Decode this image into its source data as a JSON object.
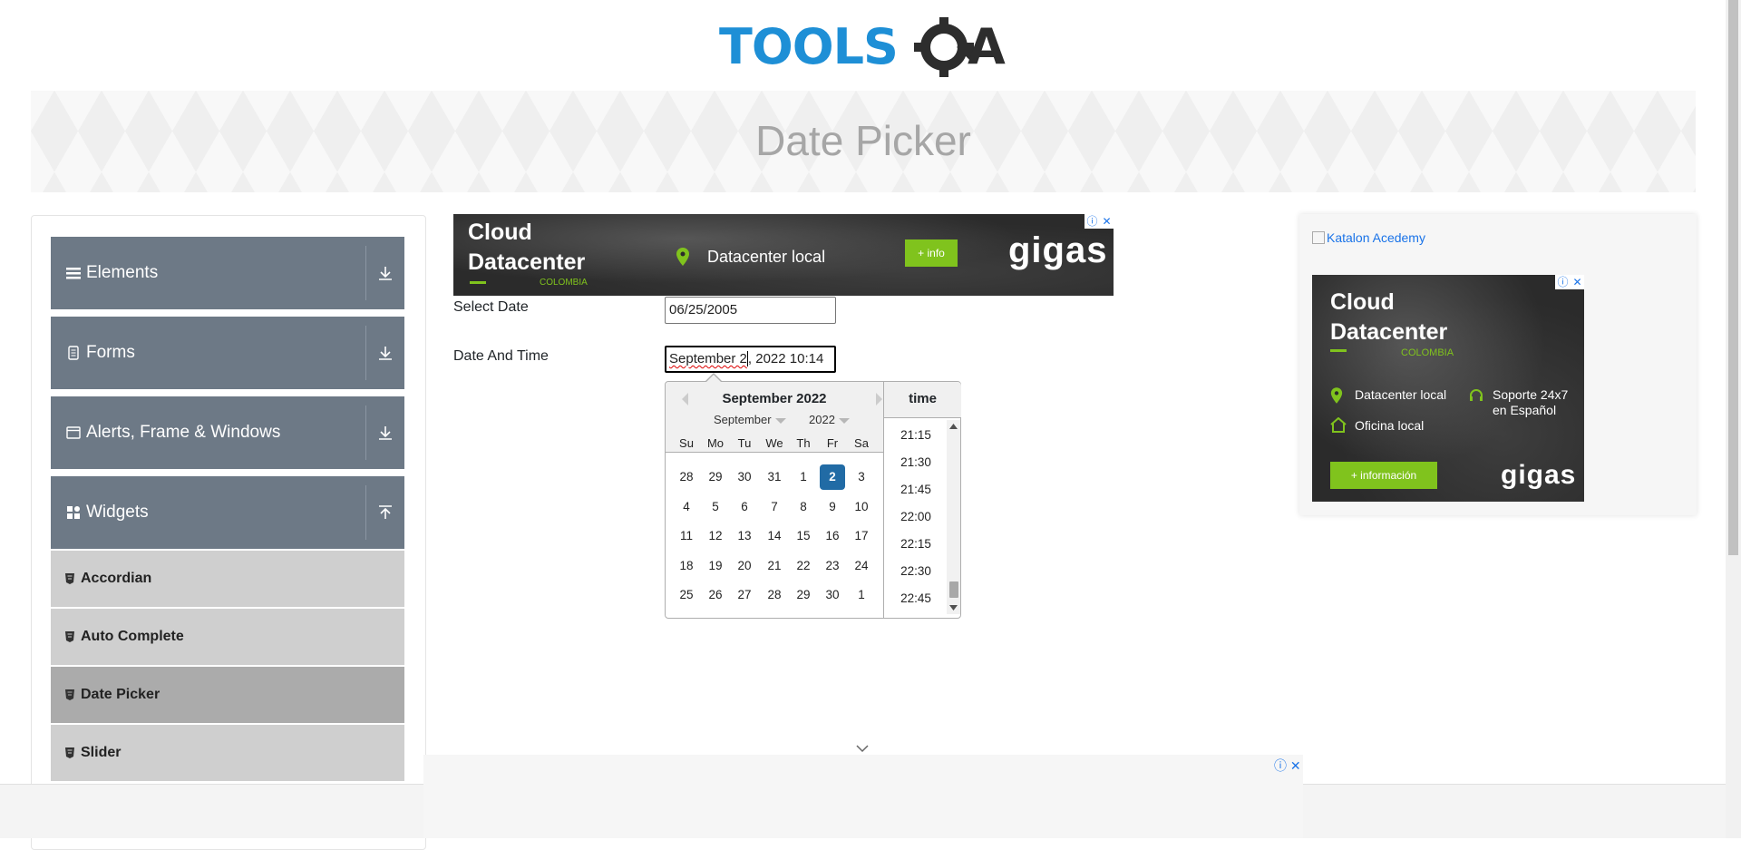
{
  "header": {
    "logo_text": "TOOLSQA",
    "page_title": "Date Picker"
  },
  "sidebar": {
    "groups": [
      {
        "label": "Elements",
        "icon": "hamburger-icon",
        "state": "collapsed"
      },
      {
        "label": "Forms",
        "icon": "document-icon",
        "state": "collapsed"
      },
      {
        "label": "Alerts, Frame & Windows",
        "icon": "window-icon",
        "state": "collapsed"
      },
      {
        "label": "Widgets",
        "icon": "grid-icon",
        "state": "expanded"
      }
    ],
    "widgets_items": [
      {
        "label": "Accordian",
        "active": false
      },
      {
        "label": "Auto Complete",
        "active": false
      },
      {
        "label": "Date Picker",
        "active": true
      },
      {
        "label": "Slider",
        "active": false
      }
    ]
  },
  "top_ad": {
    "headline_1": "Cloud",
    "headline_2": "Datacenter",
    "country": "COLOMBIA",
    "location": "Datacenter local",
    "cta": "+ info",
    "brand": "gigas"
  },
  "form": {
    "select_date_label": "Select Date",
    "select_date_value": "06/25/2005",
    "date_time_label": "Date And Time",
    "date_time_value_a": "September 2",
    "date_time_value_b": ", 2022 10:14"
  },
  "calendar": {
    "title": "September 2022",
    "month_select": "September",
    "year_select": "2022",
    "weekdays": [
      "Su",
      "Mo",
      "Tu",
      "We",
      "Th",
      "Fr",
      "Sa"
    ],
    "weeks": [
      [
        "28",
        "29",
        "30",
        "31",
        "1",
        "2",
        "3"
      ],
      [
        "4",
        "5",
        "6",
        "7",
        "8",
        "9",
        "10"
      ],
      [
        "11",
        "12",
        "13",
        "14",
        "15",
        "16",
        "17"
      ],
      [
        "18",
        "19",
        "20",
        "21",
        "22",
        "23",
        "24"
      ],
      [
        "25",
        "26",
        "27",
        "28",
        "29",
        "30",
        "1"
      ]
    ],
    "selected_day": "2",
    "time_header": "time",
    "time_slots": [
      "21:15",
      "21:30",
      "21:45",
      "22:00",
      "22:15",
      "22:30",
      "22:45"
    ]
  },
  "right_ad": {
    "image_alt": "Katalon Acedemy",
    "headline_1": "Cloud",
    "headline_2": "Datacenter",
    "country": "COLOMBIA",
    "feature_1": "Datacenter local",
    "feature_2": "Soporte 24x7 en Español",
    "feature_3": "Oficina local",
    "cta": "+ información",
    "brand": "gigas"
  },
  "colors": {
    "brand_blue": "#1e8fd6",
    "sidebar_group": "#6d7986",
    "selected_day": "#216ba5",
    "ad_green": "#80c31d"
  }
}
